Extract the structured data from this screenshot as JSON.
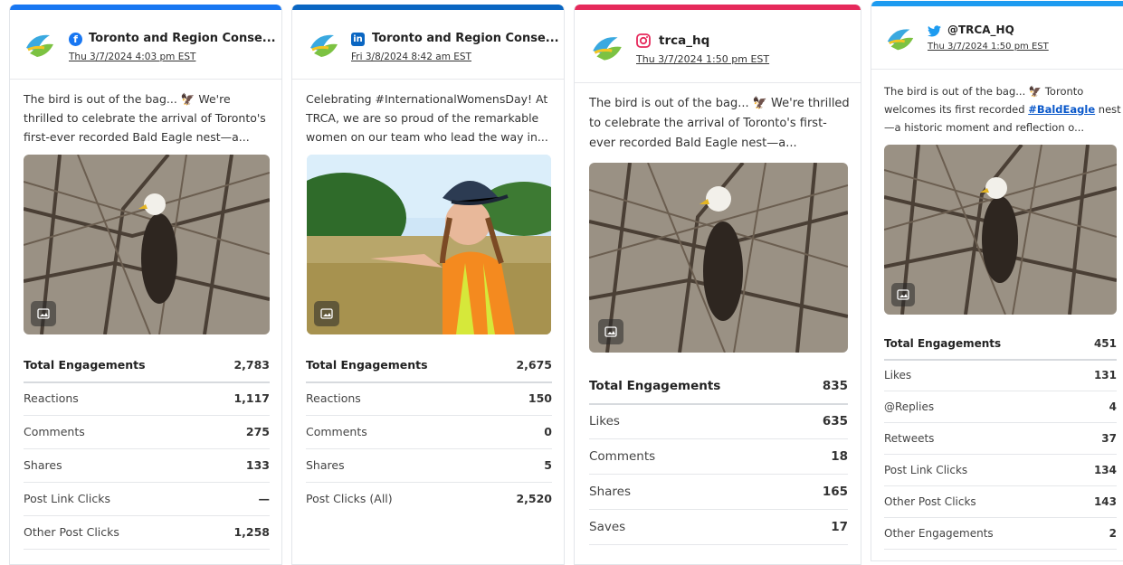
{
  "colors": {
    "facebook_bar": "#1877f2",
    "linkedin_bar": "#0a66c2",
    "instagram_bar": "#e6295b",
    "twitter_bar": "#1d9bf0"
  },
  "cards": [
    {
      "network_icon": "facebook-icon",
      "author": "Toronto and Region Conse...",
      "date": "Thu 3/7/2024 4:03 pm EST",
      "text": "The bird is out of the bag... 🦅 We're thrilled to celebrate the arrival of Toronto's first-ever recorded Bald Eagle nest—a...",
      "photo": "bald-eagle-photo",
      "metrics": [
        {
          "label": "Total Engagements",
          "value": "2,783"
        },
        {
          "label": "Reactions",
          "value": "1,117"
        },
        {
          "label": "Comments",
          "value": "275"
        },
        {
          "label": "Shares",
          "value": "133"
        },
        {
          "label": "Post Link Clicks",
          "value": "—"
        },
        {
          "label": "Other Post Clicks",
          "value": "1,258"
        }
      ]
    },
    {
      "network_icon": "linkedin-icon",
      "author": "Toronto and Region Conse...",
      "date": "Fri 3/8/2024 8:42 am EST",
      "text": "Celebrating #InternationalWomensDay! At TRCA, we are so proud of the remarkable women on our team who lead the way in...",
      "photo": "field-worker-photo",
      "metrics": [
        {
          "label": "Total Engagements",
          "value": "2,675"
        },
        {
          "label": "Reactions",
          "value": "150"
        },
        {
          "label": "Comments",
          "value": "0"
        },
        {
          "label": "Shares",
          "value": "5"
        },
        {
          "label": "Post Clicks (All)",
          "value": "2,520"
        }
      ]
    },
    {
      "network_icon": "instagram-icon",
      "author": "trca_hq",
      "date": "Thu 3/7/2024 1:50 pm EST",
      "text": "The bird is out of the bag... 🦅 We're thrilled to celebrate the arrival of Toronto's first-ever recorded Bald Eagle nest—a...",
      "photo": "bald-eagle-photo",
      "metrics": [
        {
          "label": "Total Engagements",
          "value": "835"
        },
        {
          "label": "Likes",
          "value": "635"
        },
        {
          "label": "Comments",
          "value": "18"
        },
        {
          "label": "Shares",
          "value": "165"
        },
        {
          "label": "Saves",
          "value": "17"
        }
      ]
    },
    {
      "network_icon": "twitter-icon",
      "author": "@TRCA_HQ",
      "date": "Thu 3/7/2024 1:50 pm EST",
      "text_before": "The bird is out of the bag... 🦅 Toronto welcomes its first recorded ",
      "hashtag": "#BaldEagle",
      "text_after": " nest—a historic moment and reflection o...",
      "photo": "bald-eagle-photo",
      "metrics": [
        {
          "label": "Total Engagements",
          "value": "451"
        },
        {
          "label": "Likes",
          "value": "131"
        },
        {
          "label": "@Replies",
          "value": "4"
        },
        {
          "label": "Retweets",
          "value": "37"
        },
        {
          "label": "Post Link Clicks",
          "value": "134"
        },
        {
          "label": "Other Post Clicks",
          "value": "143"
        },
        {
          "label": "Other Engagements",
          "value": "2"
        }
      ]
    }
  ]
}
